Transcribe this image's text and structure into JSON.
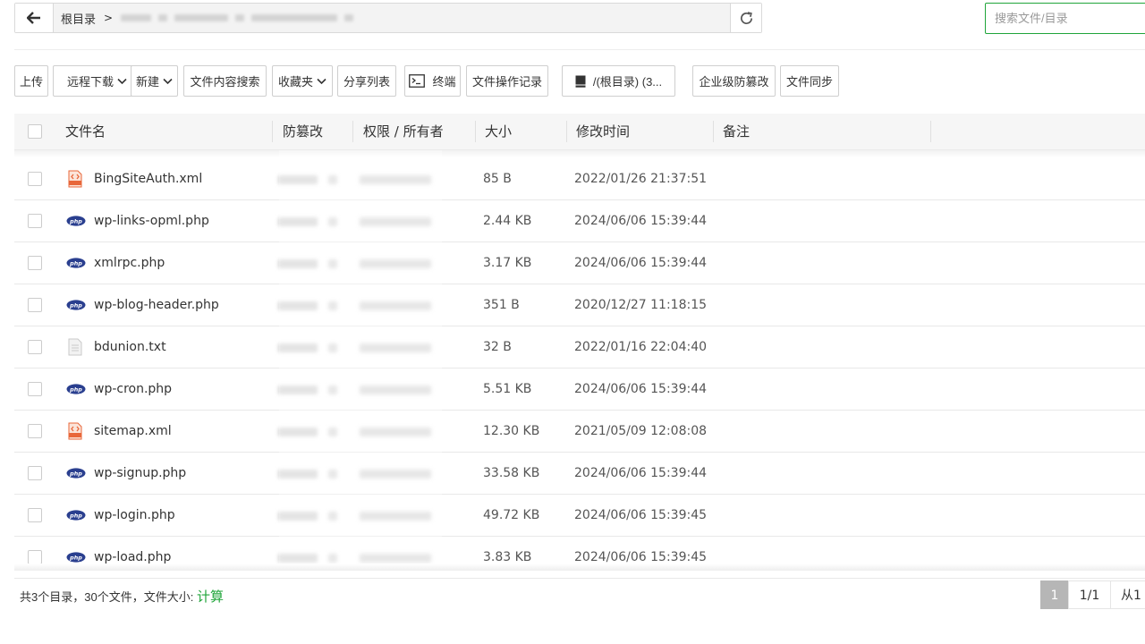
{
  "path_bar": {
    "root_label": "根目录",
    "separator": ">"
  },
  "search": {
    "placeholder": "搜索文件/目录"
  },
  "toolbar": {
    "upload": "上传",
    "remote_download": "远程下载",
    "new": "新建",
    "content_search": "文件内容搜索",
    "favorites": "收藏夹",
    "share_list": "分享列表",
    "terminal": "终端",
    "op_log": "文件操作记录",
    "disk": "/(根目录) (3...",
    "tamper_proof": "企业级防篡改",
    "file_sync": "文件同步"
  },
  "table": {
    "headers": {
      "name": "文件名",
      "tamper": "防篡改",
      "perm_owner": "权限 / 所有者",
      "size": "大小",
      "mtime": "修改时间",
      "note": "备注"
    },
    "rows": [
      {
        "name": "BingSiteAuth.xml",
        "type": "xml",
        "size": "85 B",
        "mtime": "2022/01/26 21:37:51"
      },
      {
        "name": "wp-links-opml.php",
        "type": "php",
        "size": "2.44 KB",
        "mtime": "2024/06/06 15:39:44"
      },
      {
        "name": "xmlrpc.php",
        "type": "php",
        "size": "3.17 KB",
        "mtime": "2024/06/06 15:39:44"
      },
      {
        "name": "wp-blog-header.php",
        "type": "php",
        "size": "351 B",
        "mtime": "2020/12/27 11:18:15"
      },
      {
        "name": "bdunion.txt",
        "type": "txt",
        "size": "32 B",
        "mtime": "2022/01/16 22:04:40"
      },
      {
        "name": "wp-cron.php",
        "type": "php",
        "size": "5.51 KB",
        "mtime": "2024/06/06 15:39:44"
      },
      {
        "name": "sitemap.xml",
        "type": "xml",
        "size": "12.30 KB",
        "mtime": "2021/05/09 12:08:08"
      },
      {
        "name": "wp-signup.php",
        "type": "php",
        "size": "33.58 KB",
        "mtime": "2024/06/06 15:39:44"
      },
      {
        "name": "wp-login.php",
        "type": "php",
        "size": "49.72 KB",
        "mtime": "2024/06/06 15:39:45"
      },
      {
        "name": "wp-load.php",
        "type": "php",
        "size": "3.83 KB",
        "mtime": "2024/06/06 15:39:45"
      }
    ]
  },
  "footer": {
    "summary": "共3个目录，30个文件，文件大小:",
    "calc_label": "计算",
    "pager": {
      "current": "1",
      "total": "1/1",
      "from": "从1"
    }
  },
  "colors": {
    "accent": "#20a53a",
    "php_icon": "#2a3f8f",
    "xml_icon": "#e8673a"
  }
}
